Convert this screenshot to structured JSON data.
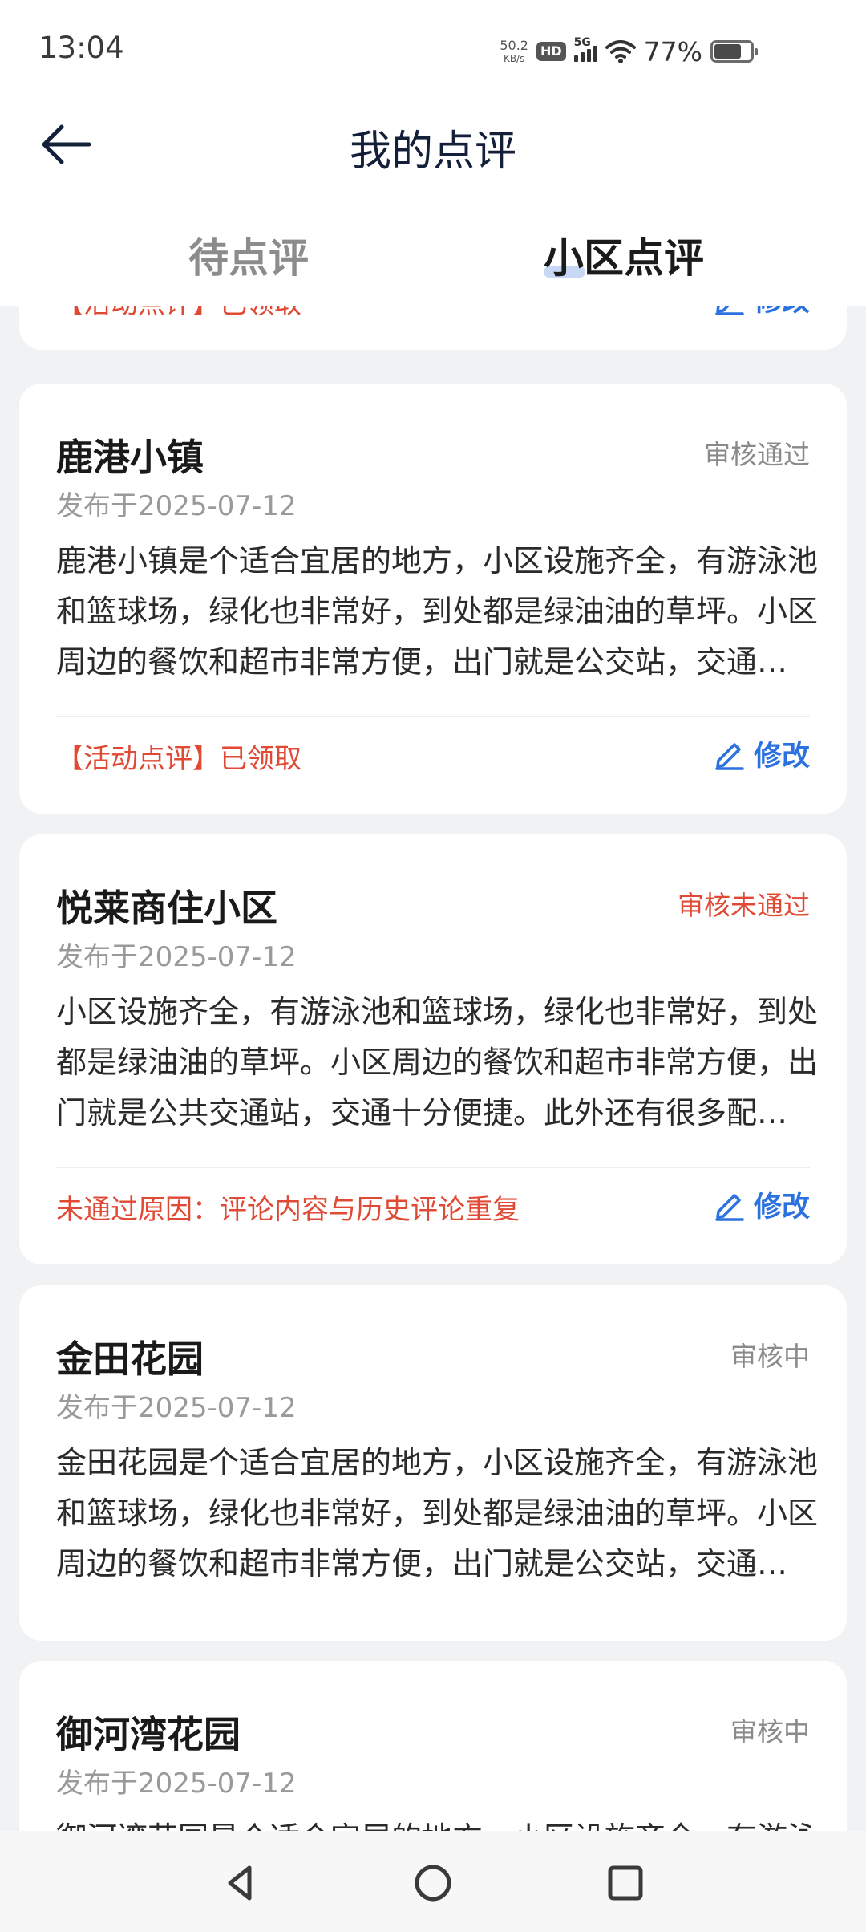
{
  "status_bar": {
    "time": "13:04",
    "net_speed": "50.2",
    "net_unit": "KB/s",
    "hd": "HD",
    "network": "5G",
    "battery_percent": "77%"
  },
  "nav": {
    "title": "我的点评"
  },
  "tabs": [
    {
      "label": "待点评",
      "active": false
    },
    {
      "label": "小区点评",
      "active": true
    }
  ],
  "partial_card": {
    "footer_text": "【活动点评】已领取",
    "edit_label": "修改"
  },
  "reviews": [
    {
      "name": "鹿港小镇",
      "status": "审核通过",
      "date": "发布于2025-07-12",
      "body": "鹿港小镇是个适合宜居的地方，小区设施齐全，有游泳池和篮球场，绿化也非常好，到处都是绿油油的草坪。小区周边的餐饮和超市非常方便，出门就是公交站，交通十分便捷。",
      "footer_text": "【活动点评】已领取",
      "edit_label": "修改"
    },
    {
      "name": "悦莱商住小区",
      "status": "审核未通过",
      "date": "发布于2025-07-12",
      "body": "小区设施齐全，有游泳池和篮球场，绿化也非常好，到处都是绿油油的草坪。小区周边的餐饮和超市非常方便，出门就是公共交通站，交通十分便捷。此外还有很多配套设施。",
      "footer_text": "未通过原因：评论内容与历史评论重复",
      "edit_label": "修改"
    },
    {
      "name": "金田花园",
      "status": "审核中",
      "date": "发布于2025-07-12",
      "body": "金田花园是个适合宜居的地方，小区设施齐全，有游泳池和篮球场，绿化也非常好，到处都是绿油油的草坪。小区周边的餐饮和超市非常方便，出门就是公交站，交通十分便捷。"
    },
    {
      "name": "御河湾花园",
      "status": "审核中",
      "date": "发布于2025-07-12",
      "body": "御河湾花园是个适合宜居的地方，小区设施齐全，有游泳池和篮球场，绿化也非常好。"
    }
  ],
  "colors": {
    "accent_blue": "#2b72e0",
    "reject_red": "#e04a35",
    "background": "#f1f2f4"
  },
  "icons": {
    "back": "arrow-left-icon",
    "edit": "pencil-icon",
    "sys_back": "triangle-back-icon",
    "sys_home": "circle-home-icon",
    "sys_recent": "square-recent-icon"
  }
}
